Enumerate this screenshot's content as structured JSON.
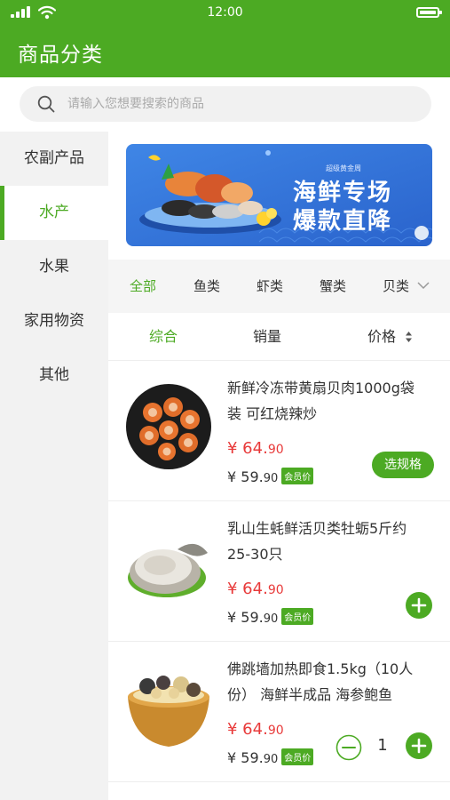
{
  "status": {
    "time": "12:00"
  },
  "header": {
    "title": "商品分类"
  },
  "search": {
    "placeholder": "请输入您想要搜索的商品",
    "value": ""
  },
  "sidebar": {
    "items": [
      {
        "label": "农副产品",
        "active": false
      },
      {
        "label": "水产",
        "active": true
      },
      {
        "label": "水果",
        "active": false
      },
      {
        "label": "家用物资",
        "active": false
      },
      {
        "label": "其他",
        "active": false
      }
    ]
  },
  "banner": {
    "subtitle": "超级黄金周",
    "line1": "海鲜专场",
    "line2": "爆款直降"
  },
  "subtabs": [
    "全部",
    "鱼类",
    "虾类",
    "蟹类",
    "贝类"
  ],
  "sort": {
    "comprehensive": "综合",
    "sales": "销量",
    "price": "价格"
  },
  "products": [
    {
      "name": "新鲜冷冻带黄扇贝肉1000g袋装 可红烧辣炒",
      "price_int": "¥ 64.",
      "price_dec": "90",
      "member_int": "¥ 59.",
      "member_dec": "90",
      "member_label": "会员价",
      "action_label": "选规格",
      "image": "scallop-plate"
    },
    {
      "name": "乳山生蚝鲜活贝类牡蛎5斤约25-30只",
      "price_int": "¥ 64.",
      "price_dec": "90",
      "member_int": "¥ 59.",
      "member_dec": "90",
      "member_label": "会员价",
      "image": "oyster"
    },
    {
      "name": "佛跳墙加热即食1.5kg（10人份） 海鲜半成品 海参鲍鱼",
      "price_int": "¥ 64.",
      "price_dec": "90",
      "member_int": "¥ 59.",
      "member_dec": "90",
      "member_label": "会员价",
      "quantity": "1",
      "image": "soup-bowl"
    }
  ],
  "colors": {
    "brand": "#4caa23",
    "price": "#e83a3a"
  }
}
